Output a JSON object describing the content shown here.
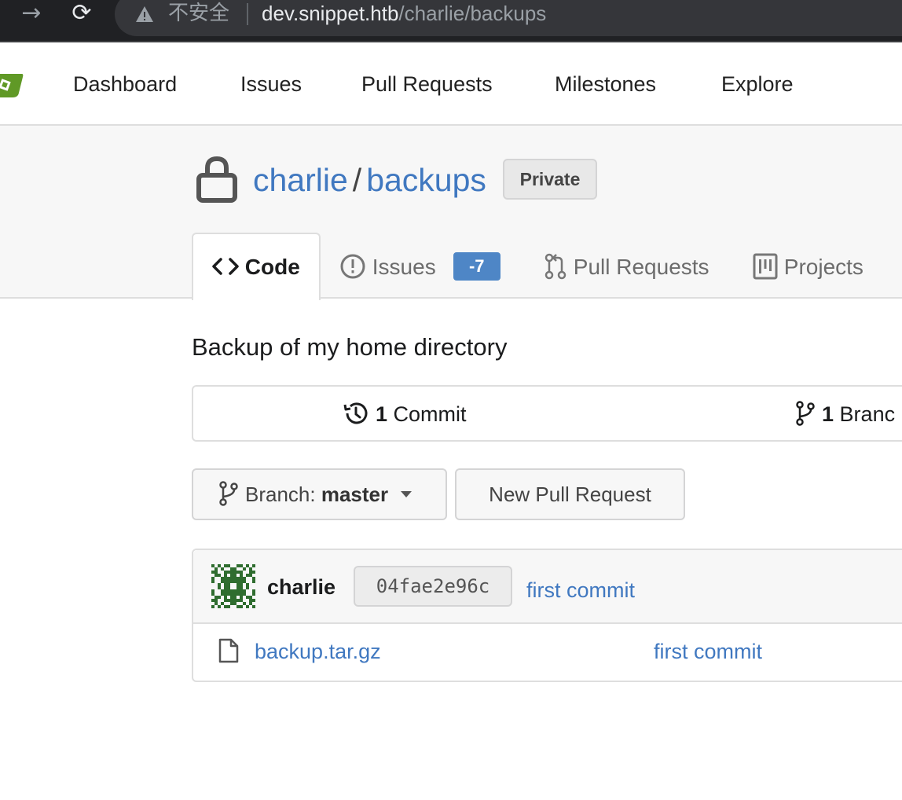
{
  "browser": {
    "forward_icon": "→",
    "reload_icon": "⟳",
    "security_warning": "不安全",
    "url_host": "dev.snippet.htb",
    "url_path": "/charlie/backups"
  },
  "top_nav": {
    "items": [
      {
        "label": "Dashboard"
      },
      {
        "label": "Issues"
      },
      {
        "label": "Pull Requests"
      },
      {
        "label": "Milestones"
      },
      {
        "label": "Explore"
      }
    ]
  },
  "repo": {
    "owner": "charlie",
    "separator": "/",
    "name": "backups",
    "visibility_badge": "Private",
    "description": "Backup of my home directory"
  },
  "tabs": {
    "code": "Code",
    "issues": "Issues",
    "issues_count": "-7",
    "pull_requests": "Pull Requests",
    "projects": "Projects"
  },
  "stats": {
    "commits_count": "1",
    "commits_label": "Commit",
    "branches_count": "1",
    "branches_label": "Branc"
  },
  "toolbar": {
    "branch_prefix": "Branch:",
    "branch_name": "master",
    "new_pr_label": "New Pull Request"
  },
  "latest_commit": {
    "author": "charlie",
    "sha": "04fae2e96c",
    "message": "first commit"
  },
  "files": [
    {
      "name": "backup.tar.gz",
      "last_commit": "first commit",
      "icon": "file-icon"
    }
  ],
  "colors": {
    "link": "#4078c0",
    "badge": "#4e86c6",
    "logo": "#609926",
    "avatar": "#2f6d2f"
  }
}
